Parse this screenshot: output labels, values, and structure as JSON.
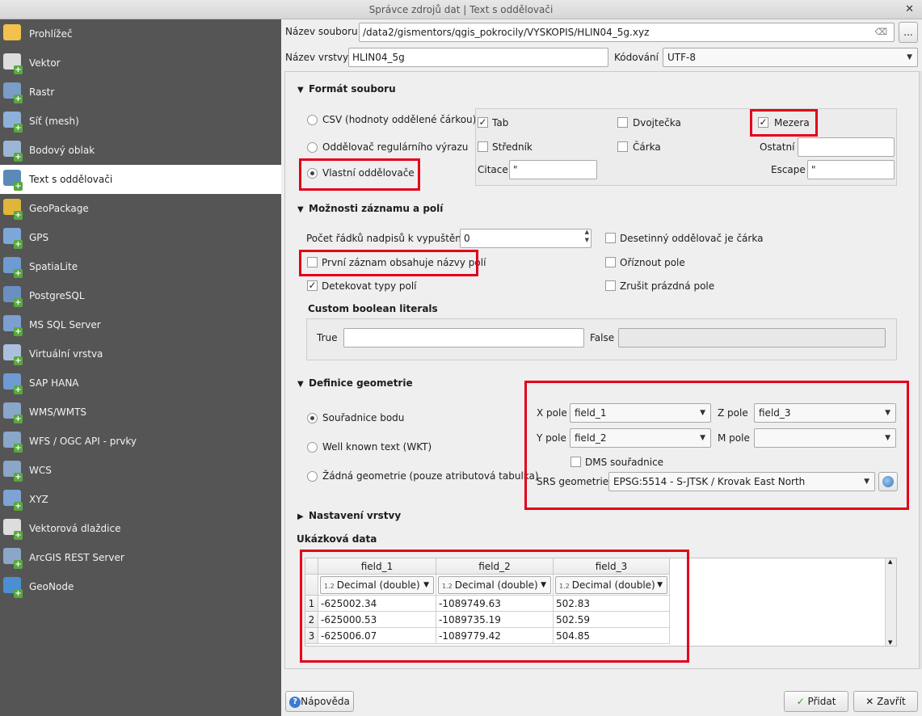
{
  "window": {
    "title": "Správce zdrojů dat | Text s oddělovači",
    "close_glyph": "✕"
  },
  "sidebar": {
    "items": [
      {
        "label": "Prohlížeč",
        "icon": "folder-icon",
        "color": "#f2c14e"
      },
      {
        "label": "Vektor",
        "icon": "vector-icon",
        "color": "#dddddd"
      },
      {
        "label": "Rastr",
        "icon": "raster-icon",
        "color": "#7a9cc6"
      },
      {
        "label": "Síť (mesh)",
        "icon": "mesh-icon",
        "color": "#8fb0d8"
      },
      {
        "label": "Bodový oblak",
        "icon": "point-cloud-icon",
        "color": "#9bb5d6"
      },
      {
        "label": "Text s oddělovači",
        "icon": "delimited-text-icon",
        "color": "#5b8ab8"
      },
      {
        "label": "GeoPackage",
        "icon": "geopackage-icon",
        "color": "#e0b53a"
      },
      {
        "label": "GPS",
        "icon": "gps-icon",
        "color": "#7da7d9"
      },
      {
        "label": "SpatiaLite",
        "icon": "spatialite-icon",
        "color": "#6e9bd1"
      },
      {
        "label": "PostgreSQL",
        "icon": "postgresql-icon",
        "color": "#6c8fc2"
      },
      {
        "label": "MS SQL Server",
        "icon": "mssql-icon",
        "color": "#7c9fcf"
      },
      {
        "label": "Virtuální vrstva",
        "icon": "virtual-layer-icon",
        "color": "#aac0dd"
      },
      {
        "label": "SAP HANA",
        "icon": "sap-hana-icon",
        "color": "#6f9ad2"
      },
      {
        "label": "WMS/WMTS",
        "icon": "wms-icon",
        "color": "#8aa6c8"
      },
      {
        "label": "WFS / OGC API - prvky",
        "icon": "wfs-icon",
        "color": "#8aa6c8"
      },
      {
        "label": "WCS",
        "icon": "wcs-icon",
        "color": "#8aa6c8"
      },
      {
        "label": "XYZ",
        "icon": "xyz-icon",
        "color": "#7ea3d4"
      },
      {
        "label": "Vektorová dlaždice",
        "icon": "vector-tile-icon",
        "color": "#dddddd"
      },
      {
        "label": "ArcGIS REST Server",
        "icon": "arcgis-icon",
        "color": "#8aa6c8"
      },
      {
        "label": "GeoNode",
        "icon": "geonode-icon",
        "color": "#4b8fd0"
      }
    ]
  },
  "file": {
    "name_label": "Název souboru",
    "name_value": "/data2/gismentors/qgis_pokrocily/VYSKOPIS/HLIN04_5g.xyz",
    "browse_label": "...",
    "layer_label": "Název vrstvy",
    "layer_value": "HLIN04_5g",
    "encoding_label": "Kódování",
    "encoding_value": "UTF-8"
  },
  "format": {
    "title": "Formát souboru",
    "csv_label": "CSV (hodnoty oddělené čárkou)",
    "regex_label": "Oddělovač regulárního výrazu",
    "custom_label": "Vlastní oddělovače",
    "tab_label": "Tab",
    "colon_label": "Dvojtečka",
    "space_label": "Mezera",
    "semicolon_label": "Středník",
    "comma_label": "Čárka",
    "other_label": "Ostatní",
    "quote_label": "Citace",
    "quote_value": "\"",
    "escape_label": "Escape",
    "escape_value": "\""
  },
  "records": {
    "title": "Možnosti záznamu a polí",
    "skip_label": "Počet řádků nadpisů k vypuštění",
    "skip_value": "0",
    "decimal_comma_label": "Desetinný oddělovač je čárka",
    "first_record_label": "První záznam obsahuje názvy polí",
    "trim_label": "Oříznout pole",
    "detect_label": "Detekovat typy polí",
    "discard_empty_label": "Zrušit prázdná pole",
    "boolean_title": "Custom boolean literals",
    "true_label": "True",
    "false_label": "False"
  },
  "geometry": {
    "title": "Definice geometrie",
    "point_label": "Souřadnice bodu",
    "wkt_label": "Well known text (WKT)",
    "none_label": "Žádná geometrie (pouze atributová tabulka)",
    "x_label": "X pole",
    "x_value": "field_1",
    "y_label": "Y pole",
    "y_value": "field_2",
    "z_label": "Z pole",
    "z_value": "field_3",
    "m_label": "M pole",
    "m_value": "",
    "dms_label": "DMS souřadnice",
    "srs_label": "SRS geometrie",
    "srs_value": "EPSG:5514 - S-JTSK / Krovak East North"
  },
  "layer_settings": {
    "title": "Nastavení vrstvy"
  },
  "preview": {
    "title": "Ukázková data",
    "columns": [
      "field_1",
      "field_2",
      "field_3"
    ],
    "type_prefix": "1.2",
    "types": [
      "Decimal (double)",
      "Decimal (double)",
      "Decimal (double)"
    ],
    "rows": [
      {
        "n": "1",
        "cells": [
          "-625002.34",
          "-1089749.63",
          "502.83"
        ]
      },
      {
        "n": "2",
        "cells": [
          "-625000.53",
          "-1089735.19",
          "502.59"
        ]
      },
      {
        "n": "3",
        "cells": [
          "-625006.07",
          "-1089779.42",
          "504.85"
        ]
      }
    ]
  },
  "buttons": {
    "help": "Nápověda",
    "add": "Přidat",
    "close": "Zavřít"
  },
  "accent": {
    "highlight": "#e3001b",
    "sidebar_bg": "#555555"
  }
}
